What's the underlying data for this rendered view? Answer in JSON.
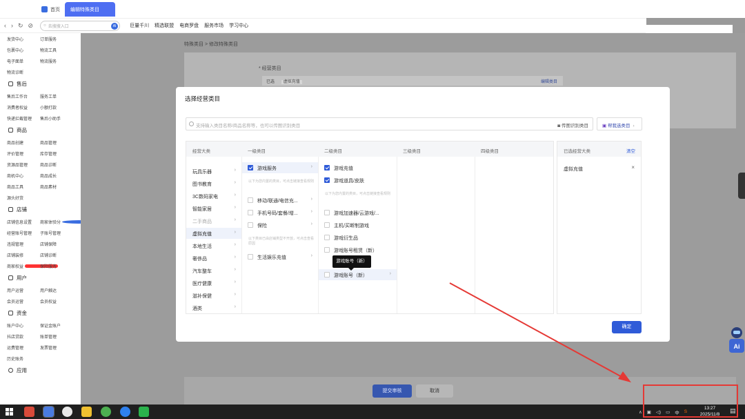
{
  "tabs": [
    {
      "label": "首页"
    },
    {
      "label": "编辑特殊类目"
    }
  ],
  "navbar": {
    "icons": [
      "back-icon",
      "forward-icon",
      "refresh-icon",
      "link-icon"
    ],
    "search_placeholder": "去搜搜入口",
    "search_ai": "AI",
    "links": [
      "巨量千川",
      "精选联盟",
      "电商罗盘",
      "服务市场",
      "学习中心"
    ]
  },
  "sidebar": {
    "top_rows": [
      [
        "发货中心",
        "订单服务"
      ],
      [
        "包裹中心",
        "物流工具"
      ],
      [
        "电子面单",
        "物流服务"
      ],
      [
        "物流诊断",
        ""
      ]
    ],
    "sections": [
      {
        "title": "售后",
        "rows": [
          [
            "售后工作台",
            "服务工单"
          ],
          [
            "消费者权益",
            "小额打款"
          ],
          [
            "快递拦截管理",
            "售后小助手"
          ]
        ]
      },
      {
        "title": "商品",
        "rows": [
          [
            "商品创建",
            "商品管理"
          ],
          [
            "评价管理",
            "库存管理"
          ],
          [
            "资源品管理",
            "商品诊断"
          ],
          [
            "商机中心",
            "商品成长"
          ],
          [
            "商品工具",
            "商品素材"
          ],
          [
            "源头好货",
            ""
          ]
        ]
      },
      {
        "title": "店铺",
        "rows": [
          [
            "店铺信息设置",
            "商家体验分"
          ],
          [
            "经营账号管理",
            "子账号管理"
          ],
          [
            "违规管理",
            "店铺保障"
          ],
          [
            "店铺装修",
            "店铺诊断"
          ],
          [
            "商家权益",
            "保险服务"
          ]
        ]
      },
      {
        "title": "用户",
        "rows": [
          [
            "用户运营",
            "用户触达"
          ],
          [
            "会员运营",
            "会员权益"
          ]
        ]
      },
      {
        "title": "资金",
        "rows": [
          [
            "账户中心",
            "保证金账户"
          ],
          [
            "抖店贷款",
            "账单管理"
          ],
          [
            "运费管理",
            "发票管理"
          ],
          [
            "历史账务",
            ""
          ]
        ]
      },
      {
        "title": "应用",
        "rows": []
      }
    ]
  },
  "page": {
    "breadcrumb": "特殊类目 > 修改特殊类目",
    "section_label": "* 经营类目",
    "selected_label": "已选",
    "selected_chip": "虚拟充值",
    "edit_link": "编辑类目",
    "submit_label": "提交审核",
    "cancel_label": "取消"
  },
  "modal": {
    "title": "选择经营类目",
    "search_placeholder": "支持输入类目名称/商品名称等，也可以传图识别类目",
    "photo_button": "传图识别类目",
    "help_button": "帮我选类目",
    "columns": [
      "经营大类",
      "一级类目",
      "二级类目",
      "三级类目",
      "四级类目"
    ],
    "col1": [
      {
        "label": "玩具乐器"
      },
      {
        "label": "图书教育"
      },
      {
        "label": "3C数码家电"
      },
      {
        "label": "智能家居"
      },
      {
        "label": "二手商品"
      },
      {
        "label": "虚拟充值",
        "active": true
      },
      {
        "label": "本地生活"
      },
      {
        "label": "奢侈品"
      },
      {
        "label": "汽车整车"
      },
      {
        "label": "医疗健康"
      },
      {
        "label": "滋补保健"
      },
      {
        "label": "酒类"
      }
    ],
    "col2_checked": "游戏服务",
    "col2_note_1": "以下为您内置的类目，可点击链接查看规则",
    "col2_items": [
      "移动/联通/电信充...",
      "手机号码/套餐/增...",
      "保险"
    ],
    "col2_note_2": "以下类目已由店铺类型不开放，可点击查看原因",
    "col2_items_2": [
      "生活娱乐充值"
    ],
    "col3_checked": [
      "游戏充值",
      "游戏道具/皮肤"
    ],
    "col3_note": "以下为您内置的类目，可点击链接查看规则",
    "col3_items": [
      "游戏加速器/云游戏/...",
      "主机/买断制游戏",
      "游戏衍生品",
      "游戏账号租赁（新）",
      "游戏账号（新）"
    ],
    "tooltip": "游戏账号（新）",
    "selected_panel_title": "已选经营大类",
    "clear_label": "清空",
    "selected_item": "虚拟充值",
    "remove_icon": "×",
    "confirm_label": "确定"
  },
  "taskbar": {
    "clock_time": "13:27",
    "clock_date": "2025/11/8",
    "ime": "中"
  },
  "colors": {
    "primary": "#2f5bd8",
    "annotation": "#e53935"
  }
}
